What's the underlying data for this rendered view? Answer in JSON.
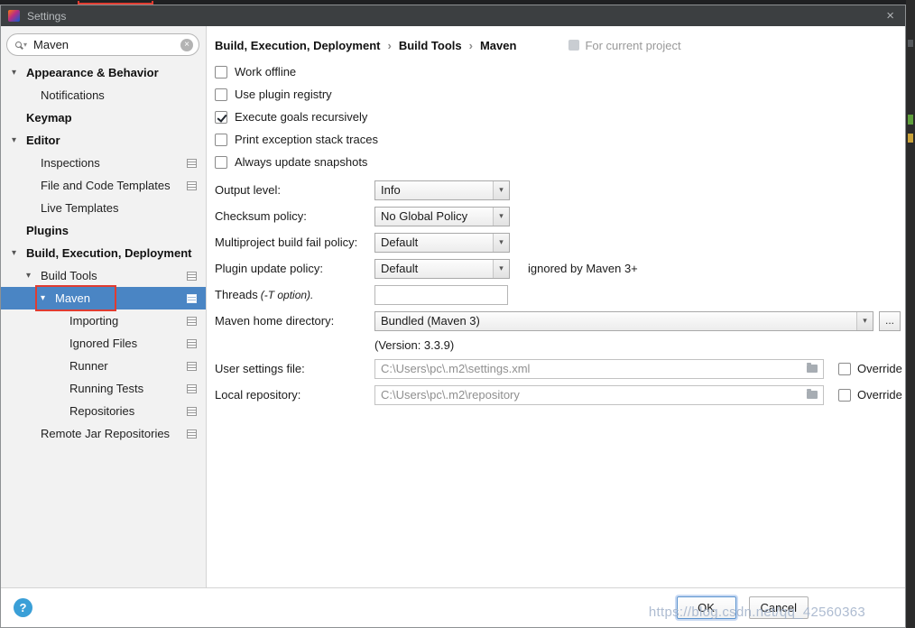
{
  "window": {
    "title": "Settings",
    "close_icon": "×"
  },
  "sidebar": {
    "search": {
      "value": "Maven",
      "clear_icon": "×"
    },
    "tree": [
      {
        "label": "Appearance & Behavior",
        "level": 0,
        "bold": true,
        "expanded": true,
        "icon": false,
        "selected": false
      },
      {
        "label": "Notifications",
        "level": 1,
        "bold": false,
        "expanded": false,
        "icon": false,
        "selected": false
      },
      {
        "label": "Keymap",
        "level": 0,
        "bold": true,
        "expanded": false,
        "icon": false,
        "selected": false
      },
      {
        "label": "Editor",
        "level": 0,
        "bold": true,
        "expanded": true,
        "icon": false,
        "selected": false
      },
      {
        "label": "Inspections",
        "level": 1,
        "bold": false,
        "expanded": false,
        "icon": true,
        "selected": false
      },
      {
        "label": "File and Code Templates",
        "level": 1,
        "bold": false,
        "expanded": false,
        "icon": true,
        "selected": false
      },
      {
        "label": "Live Templates",
        "level": 1,
        "bold": false,
        "expanded": false,
        "icon": false,
        "selected": false
      },
      {
        "label": "Plugins",
        "level": 0,
        "bold": true,
        "expanded": false,
        "icon": false,
        "selected": false
      },
      {
        "label": "Build, Execution, Deployment",
        "level": 0,
        "bold": true,
        "expanded": true,
        "icon": false,
        "selected": false
      },
      {
        "label": "Build Tools",
        "level": 1,
        "bold": false,
        "expanded": true,
        "icon": true,
        "selected": false
      },
      {
        "label": "Maven",
        "level": 2,
        "bold": false,
        "expanded": true,
        "icon": true,
        "selected": true
      },
      {
        "label": "Importing",
        "level": 3,
        "bold": false,
        "expanded": false,
        "icon": true,
        "selected": false
      },
      {
        "label": "Ignored Files",
        "level": 3,
        "bold": false,
        "expanded": false,
        "icon": true,
        "selected": false
      },
      {
        "label": "Runner",
        "level": 3,
        "bold": false,
        "expanded": false,
        "icon": true,
        "selected": false
      },
      {
        "label": "Running Tests",
        "level": 3,
        "bold": false,
        "expanded": false,
        "icon": true,
        "selected": false
      },
      {
        "label": "Repositories",
        "level": 3,
        "bold": false,
        "expanded": false,
        "icon": true,
        "selected": false
      },
      {
        "label": "Remote Jar Repositories",
        "level": 1,
        "bold": false,
        "expanded": false,
        "icon": true,
        "selected": false
      }
    ]
  },
  "breadcrumb": {
    "items": [
      "Build, Execution, Deployment",
      "Build Tools",
      "Maven"
    ],
    "separator": "›",
    "note": "For current project"
  },
  "checkboxes": [
    {
      "label": "Work offline",
      "checked": false
    },
    {
      "label": "Use plugin registry",
      "checked": false
    },
    {
      "label": "Execute goals recursively",
      "checked": true
    },
    {
      "label": "Print exception stack traces",
      "checked": false
    },
    {
      "label": "Always update snapshots",
      "checked": false
    }
  ],
  "fields": {
    "output_level": {
      "label": "Output level:",
      "value": "Info"
    },
    "checksum_policy": {
      "label": "Checksum policy:",
      "value": "No Global Policy"
    },
    "multiproject_policy": {
      "label": "Multiproject build fail policy:",
      "value": "Default"
    },
    "plugin_update_policy": {
      "label": "Plugin update policy:",
      "value": "Default",
      "note": "ignored by Maven 3+"
    },
    "threads": {
      "label": "Threads",
      "label_suffix": "(-T option).",
      "value": ""
    },
    "maven_home": {
      "label": "Maven home directory:",
      "value": "Bundled (Maven 3)",
      "more_label": "...",
      "version_note": "(Version: 3.3.9)"
    },
    "user_settings": {
      "label": "User settings file:",
      "value": "C:\\Users\\pc\\.m2\\settings.xml",
      "override_label": "Override",
      "override_checked": false
    },
    "local_repo": {
      "label": "Local repository:",
      "value": "C:\\Users\\pc\\.m2\\repository",
      "override_label": "Override",
      "override_checked": false
    }
  },
  "footer": {
    "help_icon": "?",
    "ok_label": "OK",
    "cancel_label": "Cancel"
  },
  "watermark": "https://blog.csdn.net/qq_42560363",
  "colors": {
    "selection": "#4a85c4",
    "annotation": "#e03c31",
    "titlebar": "#3c3f41",
    "sidebar_bg": "#f2f2f2"
  }
}
